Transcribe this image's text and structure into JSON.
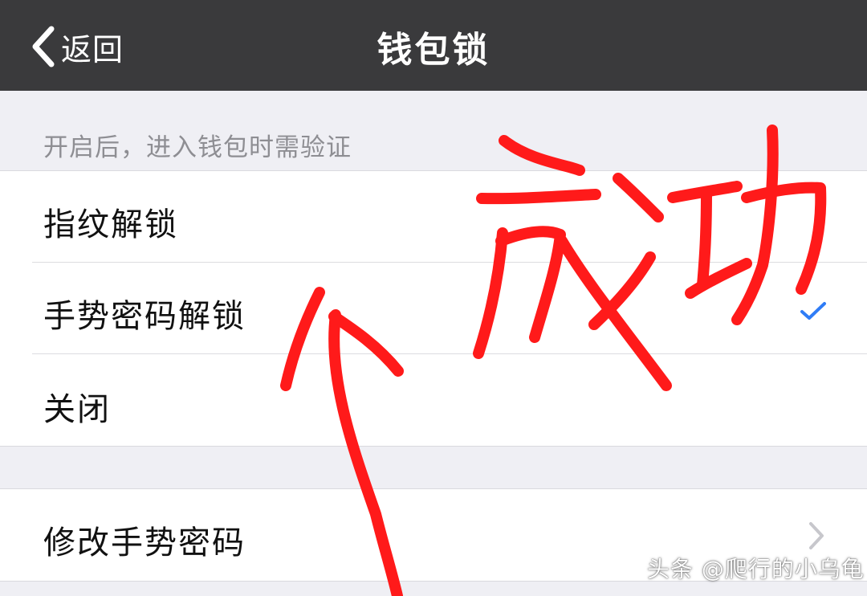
{
  "navbar": {
    "back_label": "返回",
    "title": "钱包锁"
  },
  "section": {
    "header": "开启后，进入钱包时需验证"
  },
  "lock_options": [
    {
      "label": "指纹解锁",
      "selected": false
    },
    {
      "label": "手势密码解锁",
      "selected": true
    },
    {
      "label": "关闭",
      "selected": false
    }
  ],
  "settings": {
    "change_gesture_label": "修改手势密码"
  },
  "annotation": {
    "handwritten_text": "成功",
    "color": "#ff1a1a"
  },
  "watermark": {
    "text": "头条 @爬行的小乌龟"
  },
  "colors": {
    "navbar": "#3a3a3c",
    "background": "#efeff4",
    "check": "#2f7cf6"
  },
  "icons": {
    "back": "chevron-left-icon",
    "selected": "checkmark-icon",
    "disclosure": "chevron-right-icon"
  }
}
